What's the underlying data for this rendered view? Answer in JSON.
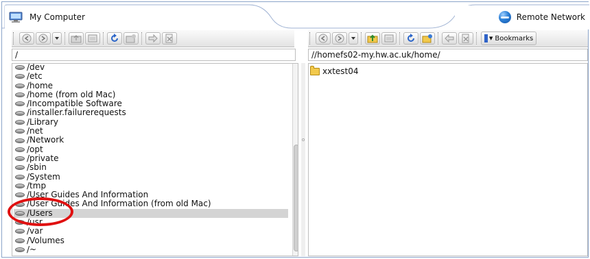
{
  "tabs": {
    "local": {
      "label": "My Computer",
      "icon": "computer-icon"
    },
    "remote": {
      "label": "Remote Network",
      "icon": "globe-icon"
    }
  },
  "toolbar_right": {
    "bookmarks_label": "Bookmarks"
  },
  "local": {
    "path": "/",
    "items": [
      "/dev",
      "/etc",
      "/home",
      "/home (from old Mac)",
      "/Incompatible Software",
      "/installer.failurerequests",
      "/Library",
      "/net",
      "/Network",
      "/opt",
      "/private",
      "/sbin",
      "/System",
      "/tmp",
      "/User Guides And Information",
      "/User Guides And Information (from old Mac)",
      "/Users",
      "/usr",
      "/var",
      "/Volumes",
      "/~"
    ],
    "selected_index": 16
  },
  "remote": {
    "path": "//homefs02-my.hw.ac.uk/home/",
    "items": [
      "xxtest04"
    ]
  },
  "colors": {
    "annotation": "#e01010",
    "selection": "#d4d4d4"
  }
}
